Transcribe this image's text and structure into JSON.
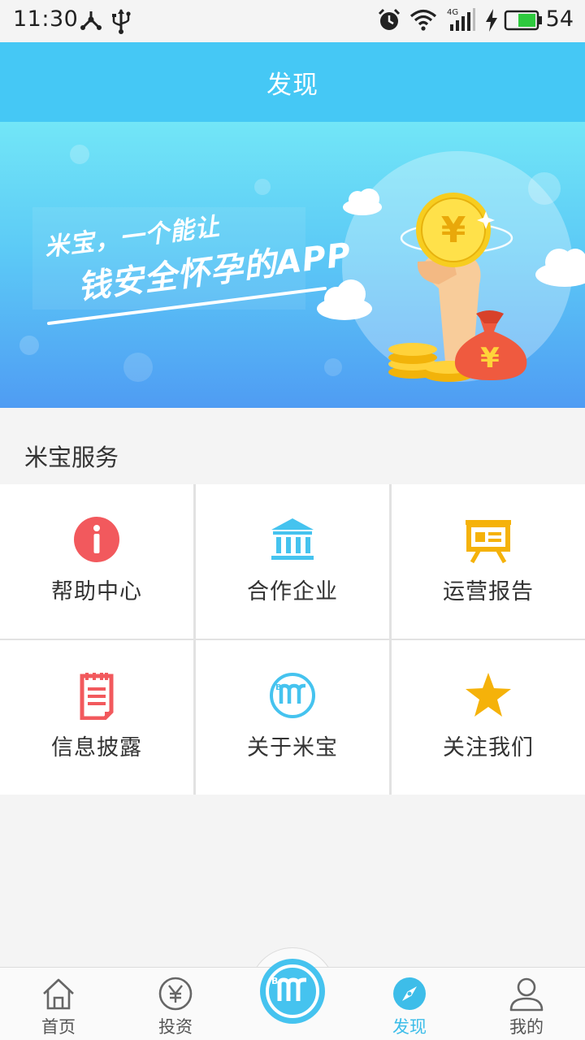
{
  "status_bar": {
    "time": "11:30",
    "battery": "54",
    "network": "4G",
    "icons": [
      "usb-debug-icon",
      "usb-icon",
      "alarm-icon",
      "wifi-icon",
      "signal-icon",
      "charging-icon",
      "battery-icon"
    ]
  },
  "header": {
    "title": "发现"
  },
  "banner": {
    "slogan_line1": "米宝，一个能让",
    "slogan_line2": "钱安全怀孕的APP",
    "coin_symbol": "¥",
    "bag_symbol": "¥"
  },
  "section": {
    "title": "米宝服务"
  },
  "services": [
    {
      "label": "帮助中心",
      "icon": "info-icon",
      "color": "#f2595d"
    },
    {
      "label": "合作企业",
      "icon": "bank-icon",
      "color": "#45c3ef"
    },
    {
      "label": "运营报告",
      "icon": "presentation-board-icon",
      "color": "#f5b20a"
    },
    {
      "label": "信息披露",
      "icon": "notepad-icon",
      "color": "#f2595d"
    },
    {
      "label": "关于米宝",
      "icon": "mibao-logo-icon",
      "color": "#45c3ef"
    },
    {
      "label": "关注我们",
      "icon": "star-icon",
      "color": "#f5b20a"
    }
  ],
  "bottom_nav": {
    "items": [
      {
        "label": "首页",
        "icon": "home-icon"
      },
      {
        "label": "投资",
        "icon": "yen-circle-icon"
      },
      {
        "label": "发现",
        "icon": "compass-icon",
        "active": true
      },
      {
        "label": "我的",
        "icon": "person-icon"
      }
    ],
    "center_icon": "mibao-logo-icon"
  },
  "colors": {
    "accent": "#45c8f5",
    "active_tab": "#3dbde9",
    "red": "#f2595d",
    "gold": "#f5b20a"
  }
}
